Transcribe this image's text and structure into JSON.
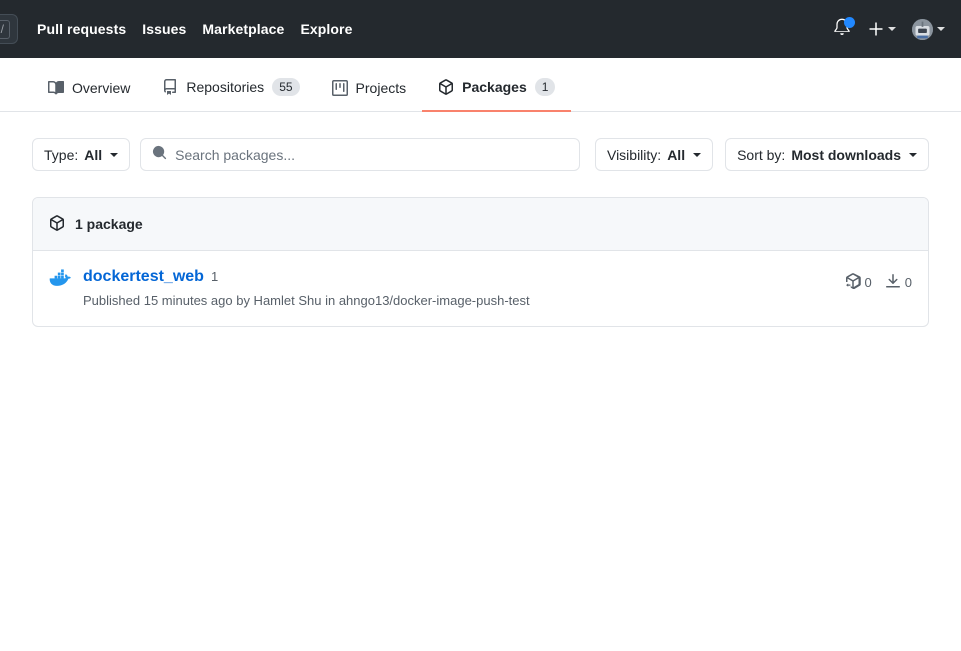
{
  "header": {
    "search_shortcut": "/",
    "nav": [
      {
        "label": "Pull requests",
        "name": "nav-pull-requests"
      },
      {
        "label": "Issues",
        "name": "nav-issues"
      },
      {
        "label": "Marketplace",
        "name": "nav-marketplace"
      },
      {
        "label": "Explore",
        "name": "nav-explore"
      }
    ],
    "icons": {
      "notifications": "bell-icon",
      "create_new": "plus-icon",
      "account": "avatar-icon"
    },
    "notification_dot_color": "#2188ff",
    "background_color": "#24292e"
  },
  "tabs": [
    {
      "label": "Overview",
      "icon": "book-icon",
      "count": "",
      "active": false
    },
    {
      "label": "Repositories",
      "icon": "repo-icon",
      "count": "55",
      "active": false
    },
    {
      "label": "Projects",
      "icon": "project-icon",
      "count": "",
      "active": false
    },
    {
      "label": "Packages",
      "icon": "package-icon",
      "count": "1",
      "active": true
    }
  ],
  "active_tab_underline_color": "#f9826c",
  "filters": {
    "type": {
      "label": "Type:",
      "value": "All"
    },
    "search": {
      "placeholder": "Search packages...",
      "value": "",
      "icon": "search-icon"
    },
    "visibility": {
      "label": "Visibility:",
      "value": "All"
    },
    "sort": {
      "label": "Sort by:",
      "value": "Most downloads"
    }
  },
  "list": {
    "header_text": "1 package",
    "header_icon": "package-icon",
    "packages": [
      {
        "icon": "docker-icon",
        "icon_color": "#2496ed",
        "name": "dockertest_web",
        "version": "1",
        "meta": "Published 15 minutes ago by Hamlet Shu in ahngo13/docker-image-push-test",
        "versions_count": "0",
        "downloads_count": "0"
      }
    ]
  }
}
